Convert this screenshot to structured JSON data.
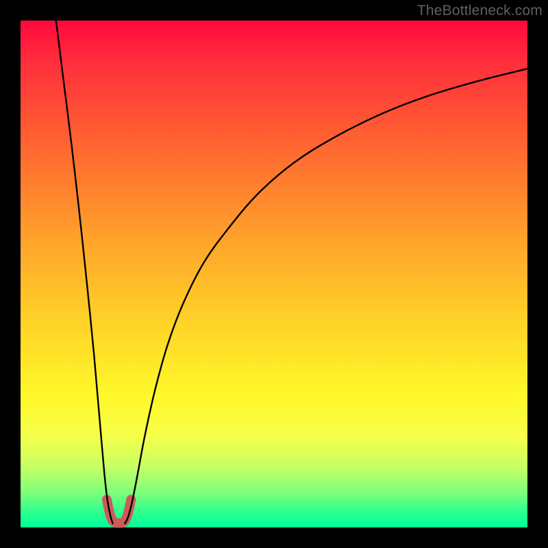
{
  "watermark": "TheBottleneck.com",
  "chart_data": {
    "type": "line",
    "title": "",
    "xlabel": "",
    "ylabel": "",
    "xlim": [
      0,
      100
    ],
    "ylim": [
      0,
      100
    ],
    "grid": false,
    "legend": false,
    "series": [
      {
        "name": "left-branch",
        "x": [
          7.0,
          8.5,
          10.0,
          11.5,
          13.0,
          14.5,
          15.8,
          16.6,
          17.2,
          17.8,
          18.2
        ],
        "y": [
          100,
          88,
          76,
          63,
          49,
          34,
          19,
          10,
          5,
          2,
          0.8
        ]
      },
      {
        "name": "right-branch",
        "x": [
          20.6,
          21.2,
          22.0,
          23.0,
          24.5,
          26.5,
          29.0,
          32.0,
          36.0,
          41.0,
          47.0,
          54.0,
          62.0,
          71.0,
          80.0,
          90.0,
          100.0
        ],
        "y": [
          0.8,
          2,
          5,
          10,
          18,
          27,
          36,
          44,
          52,
          59,
          66,
          72,
          77,
          81.5,
          85,
          88,
          90.5
        ]
      },
      {
        "name": "valley-marker",
        "x": [
          17.0,
          17.6,
          18.2,
          18.9,
          19.4,
          20.0,
          20.6,
          21.2,
          21.8
        ],
        "y": [
          5.5,
          2.8,
          1.3,
          0.9,
          0.9,
          0.9,
          1.3,
          2.8,
          5.5
        ]
      }
    ],
    "styles": {
      "left-branch": {
        "stroke": "#000000",
        "width": 2.4
      },
      "right-branch": {
        "stroke": "#000000",
        "width": 2.4
      },
      "valley-marker": {
        "stroke": "#cc5a5a",
        "width": 14,
        "linecap": "round"
      }
    }
  }
}
